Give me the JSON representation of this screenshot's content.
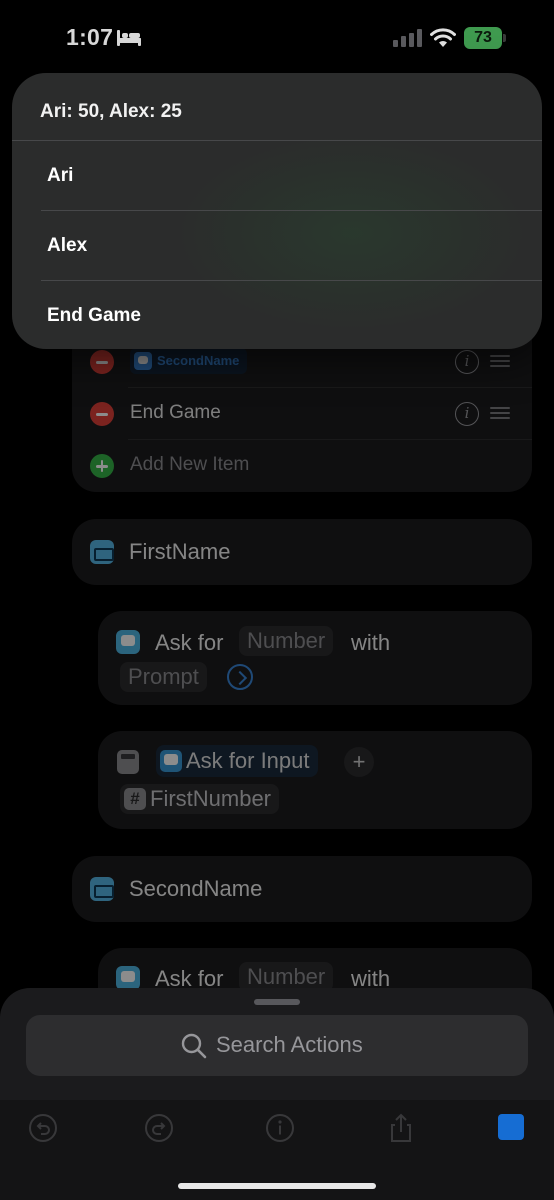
{
  "status_bar": {
    "time": "1:07",
    "battery": "73"
  },
  "menu": {
    "header": "Ari: 50, Alex: 25",
    "items": [
      "Ari",
      "Alex",
      "End Game"
    ]
  },
  "list": {
    "rows": [
      {
        "label": "SecondName"
      },
      {
        "label": "End Game"
      }
    ],
    "add_label": "Add New Item"
  },
  "actions": {
    "first_name": "FirstName",
    "ask1": {
      "ask": "Ask for",
      "type": "Number",
      "with": "with",
      "prompt": "Prompt"
    },
    "calc": {
      "input": "Ask for Input",
      "var": "FirstNumber"
    },
    "second_name": "SecondName",
    "ask2": {
      "ask": "Ask for",
      "type": "Number",
      "with": "with"
    }
  },
  "search": {
    "placeholder": "Search Actions"
  },
  "colors": {
    "accent": "#1770d8",
    "battery": "#3f9a4f",
    "remove": "#e0413a",
    "add": "#35b547"
  }
}
